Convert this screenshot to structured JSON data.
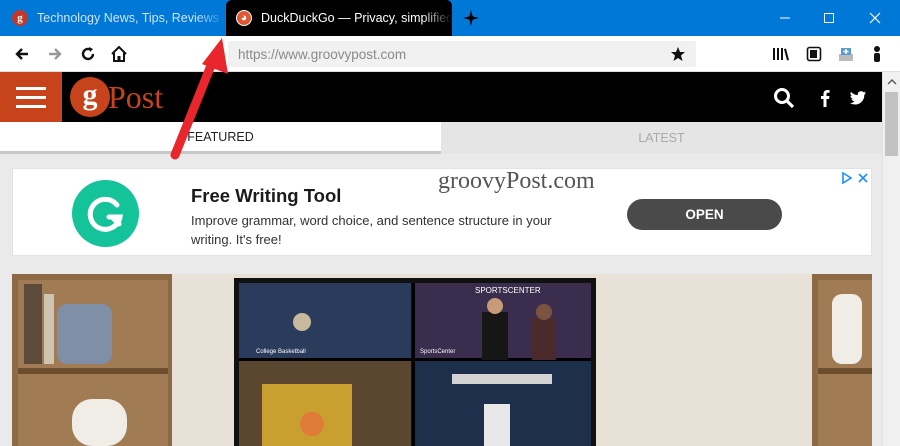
{
  "browser": {
    "tabs": [
      {
        "title": "Technology News, Tips, Reviews",
        "favicon": "groovypost-favicon",
        "active": false
      },
      {
        "title": "DuckDuckGo — Privacy, simplified",
        "favicon": "duckduckgo-favicon",
        "active": true
      }
    ],
    "url": "https://www.groovypost.com",
    "accent_color": "#0078d7"
  },
  "site": {
    "logo_letter": "g",
    "logo_text": "Post",
    "brand_color": "#c7431b",
    "nav_tabs": [
      "FEATURED",
      "LATEST"
    ],
    "watermark": "groovyPost.com"
  },
  "ad": {
    "title": "Free Writing Tool",
    "text": "Improve grammar, word choice, and sentence structure in your writing. It's free!",
    "button": "OPEN",
    "logo_color": "#15c39a"
  },
  "photo": {
    "screen_labels": [
      "SPORTSCENTER",
      "College Basketball",
      "SportsCenter"
    ]
  }
}
